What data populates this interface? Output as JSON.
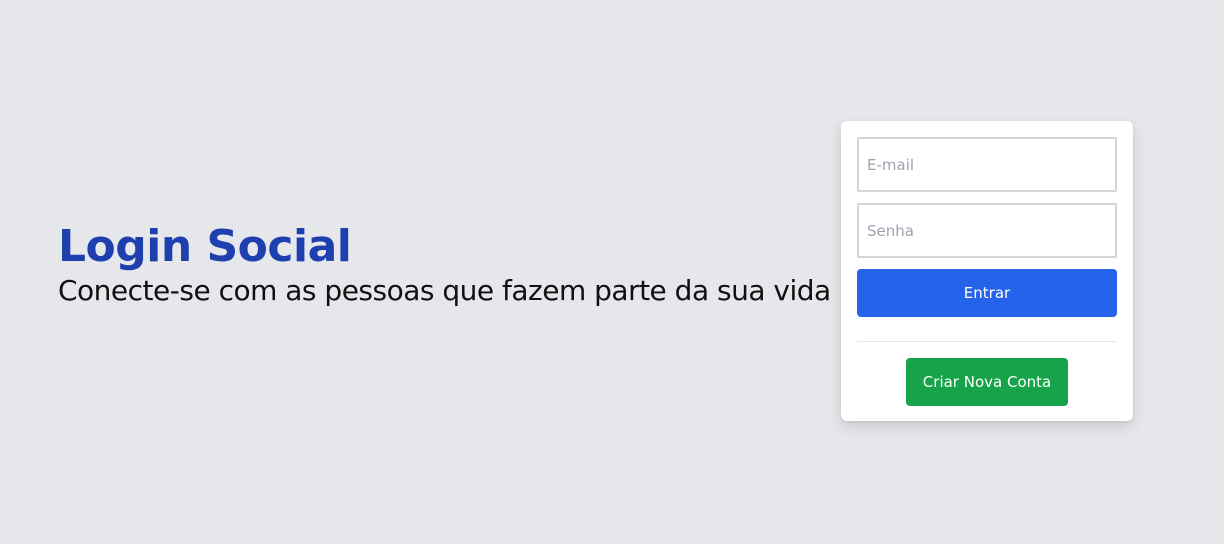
{
  "hero": {
    "title": "Login Social",
    "subtitle": "Conecte-se com as pessoas que fazem parte da sua vida"
  },
  "login_form": {
    "email_placeholder": "E-mail",
    "password_placeholder": "Senha",
    "login_label": "Entrar",
    "create_account_label": "Criar Nova Conta"
  },
  "colors": {
    "background": "#e5e7eb",
    "title": "#1e40af",
    "login_button": "#2563eb",
    "create_button": "#16a34a"
  }
}
